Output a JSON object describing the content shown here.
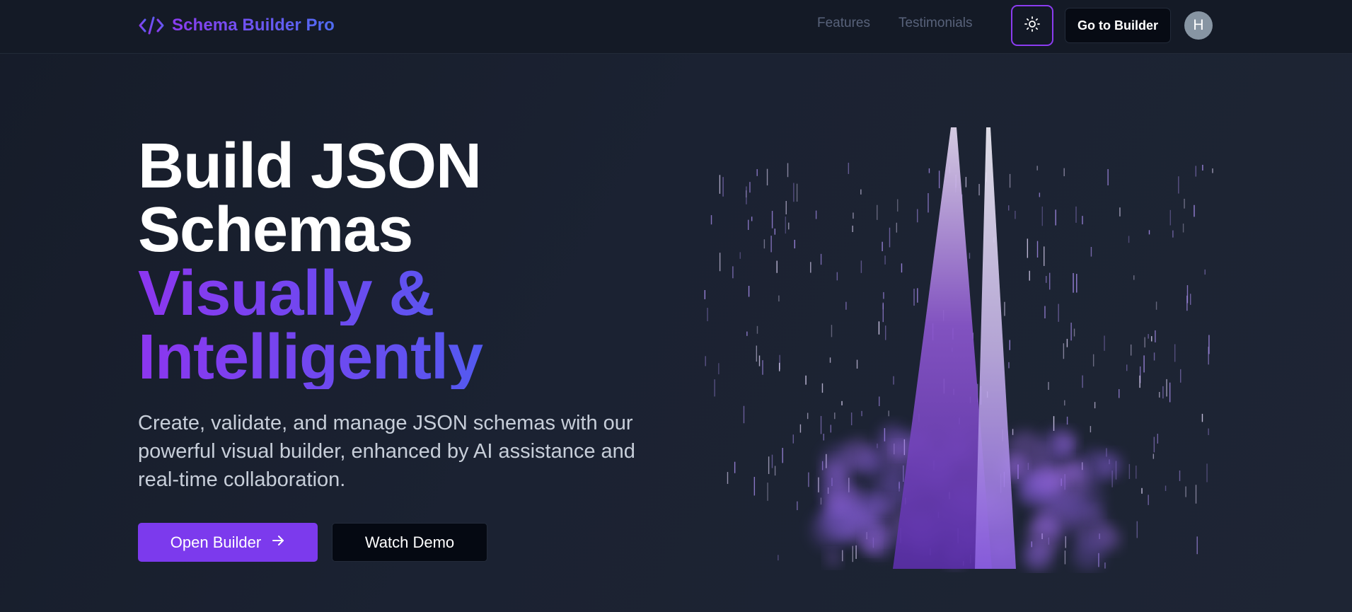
{
  "navbar": {
    "brand": "Schema Builder Pro",
    "brand_icon": "code-brackets-icon",
    "links": [
      "Features",
      "Testimonials"
    ],
    "theme_toggle_icon": "sun-icon",
    "go_to_builder": "Go to Builder",
    "avatar_initial": "H"
  },
  "hero": {
    "title_line1": "Build JSON",
    "title_line2": "Schemas",
    "title_line3": "Visually &",
    "title_line4": "Intelligently",
    "subtitle": "Create, validate, and manage JSON schemas with our powerful visual builder, enhanced by AI assistance and real-time collaboration.",
    "primary_button": "Open Builder",
    "primary_button_icon": "arrow-right-icon",
    "secondary_button": "Watch Demo"
  },
  "colors": {
    "accent": "#7c3aed",
    "accent_blue": "#4f6cf2",
    "background": "#1a2030",
    "navbar_bg": "#141a26"
  }
}
